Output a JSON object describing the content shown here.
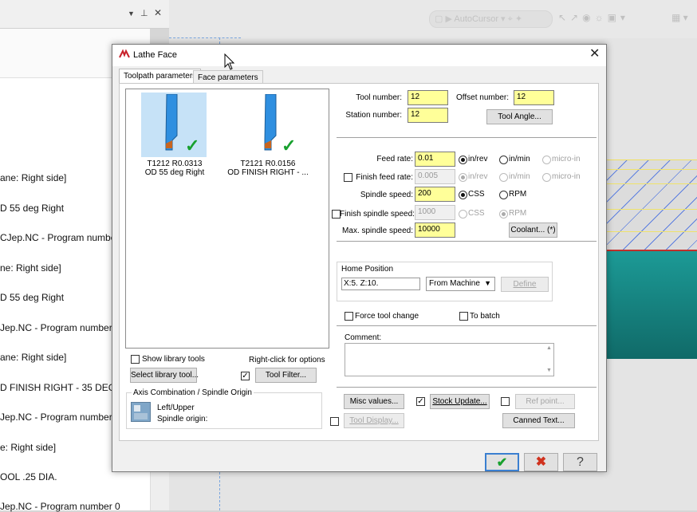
{
  "background": {
    "left_panel_lines": [
      "ane: Right side]",
      "D 55 deg Right",
      "CJep.NC - Program numbe",
      "ne: Right side]",
      "D 55 deg Right",
      "Jep.NC - Program number",
      "ane: Right side]",
      "D FINISH RIGHT - 35 DEG.",
      "Jep.NC - Program number",
      "e: Right side]",
      "OOL  .25 DIA.",
      "Jep.NC - Program number 0"
    ],
    "toolbar_ghost_label": "AutoCursor"
  },
  "dialog": {
    "title": "Lathe Face",
    "tabs": [
      "Toolpath parameters",
      "Face parameters"
    ],
    "tools": [
      {
        "line1": "T1212 R0.0313",
        "line2": "OD 55 deg Right"
      },
      {
        "line1": "T2121 R0.0156",
        "line2": "OD FINISH RIGHT - ..."
      }
    ],
    "show_library_tools": "Show library tools",
    "right_click_options": "Right-click for options",
    "select_library_tool": "Select library tool...",
    "tool_filter": "Tool Filter...",
    "axis_group_title": "Axis Combination / Spindle Origin",
    "axis_combination": "Left/Upper",
    "spindle_origin": "Spindle origin:",
    "tool_number_label": "Tool number:",
    "tool_number": "12",
    "offset_number_label": "Offset number:",
    "offset_number": "12",
    "station_number_label": "Station number:",
    "station_number": "12",
    "tool_angle": "Tool Angle...",
    "feed_rate_label": "Feed rate:",
    "feed_rate": "0.01",
    "finish_feed_rate_label": "Finish feed rate:",
    "finish_feed_rate": "0.005",
    "spindle_speed_label": "Spindle speed:",
    "spindle_speed": "200",
    "finish_spindle_speed_label": "Finish spindle speed:",
    "finish_spindle_speed": "1000",
    "max_spindle_speed_label": "Max. spindle speed:",
    "max_spindle_speed": "10000",
    "units": {
      "in_rev": "in/rev",
      "in_min": "in/min",
      "micro_in": "micro-in",
      "css": "CSS",
      "rpm": "RPM"
    },
    "coolant": "Coolant... (*)",
    "home_position_title": "Home Position",
    "home_position_value": "X:5.  Z:10.",
    "home_position_mode": "From Machine",
    "define": "Define",
    "force_tool_change": "Force tool change",
    "to_batch": "To batch",
    "comment_label": "Comment:",
    "comment": "",
    "misc_values": "Misc values...",
    "stock_update": "Stock Update...",
    "ref_point": "Ref point...",
    "tool_display": "Tool Display...",
    "canned_text": "Canned Text...",
    "colors": {
      "accent_check": "#18a02e",
      "cancel": "#d0321e",
      "input_highlight": "#ffff99"
    }
  }
}
